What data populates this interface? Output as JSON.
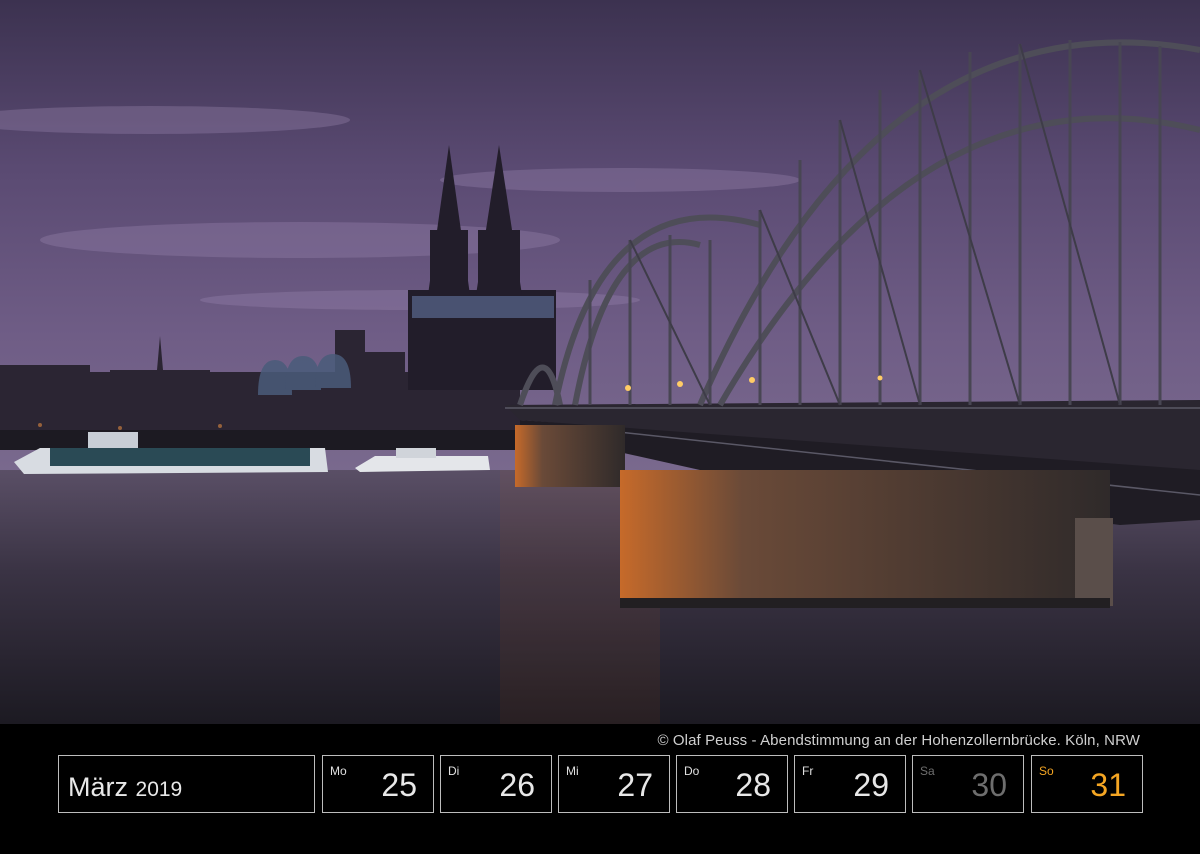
{
  "caption": "© Olaf Peuss - Abendstimmung an der Hohenzollernbrücke. Köln, NRW",
  "month": "März",
  "year": "2019",
  "days": [
    {
      "abbr": "Mo",
      "num": "25"
    },
    {
      "abbr": "Di",
      "num": "26"
    },
    {
      "abbr": "Mi",
      "num": "27"
    },
    {
      "abbr": "Do",
      "num": "28"
    },
    {
      "abbr": "Fr",
      "num": "29"
    },
    {
      "abbr": "Sa",
      "num": "30"
    },
    {
      "abbr": "So",
      "num": "31"
    }
  ],
  "colors": {
    "saturday": "#6e6e6e",
    "sunday": "#f5a623",
    "border": "#bdbdbd"
  }
}
